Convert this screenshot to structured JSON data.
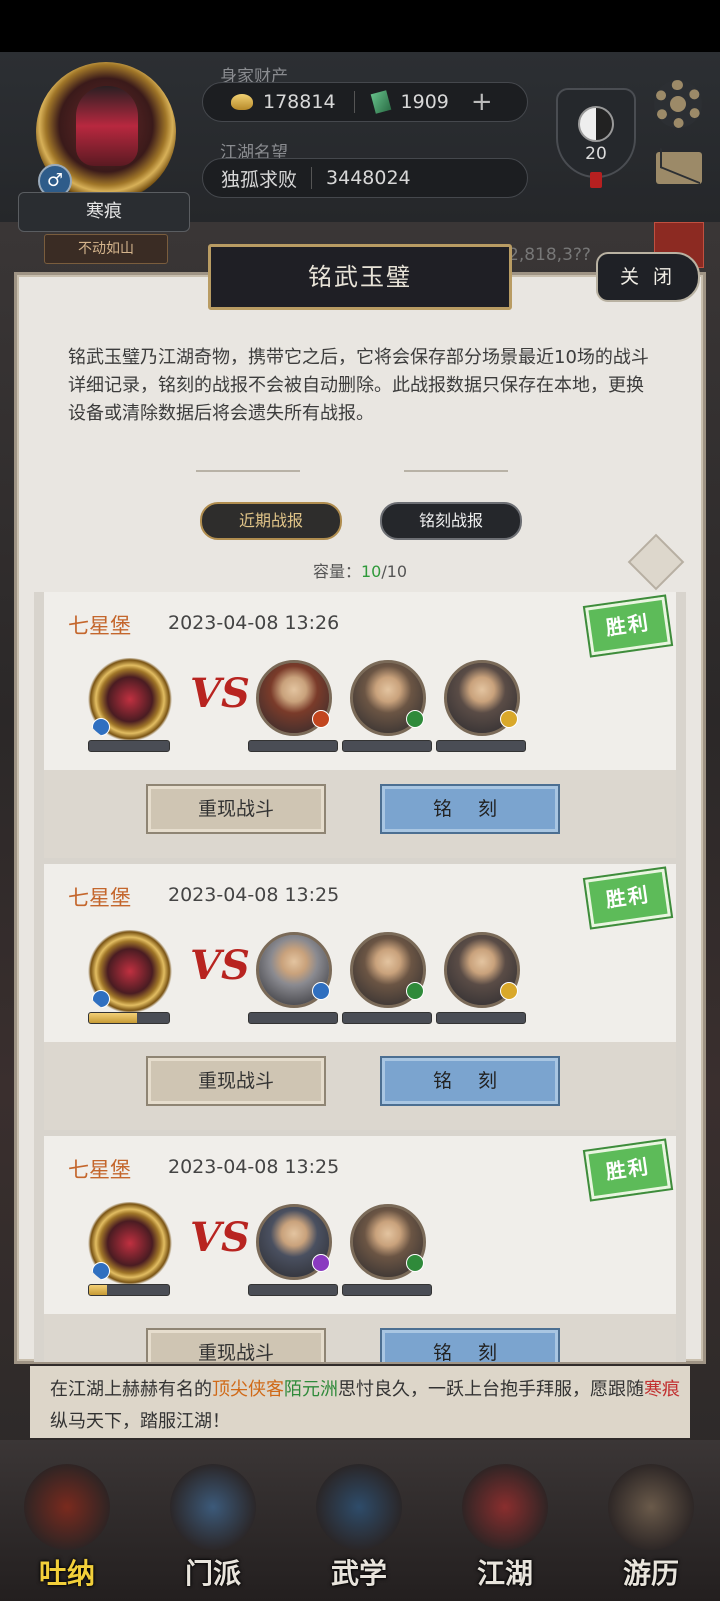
{
  "player": {
    "name": "寒痕",
    "title": "不动如山",
    "gender_icon": "♂"
  },
  "wealth": {
    "label": "身家财产",
    "gold": "178814",
    "jade": "1909",
    "plus": "+"
  },
  "reputation": {
    "label": "江湖名望",
    "rank": "独孤求败",
    "value": "3448024"
  },
  "level_badge": "20",
  "behind_text": "性：2,818,3??",
  "dialog": {
    "title": "铭武玉璧",
    "close_label": "关 闭",
    "description": "铭武玉璧乃江湖奇物，携带它之后，它将会保存部分场景最近10场的战斗详细记录，铭刻的战报不会被自动删除。此战报数据只保存在本地，更换设备或清除数据后将会遗失所有战报。",
    "tabs": [
      "近期战报",
      "铭刻战报"
    ],
    "capacity_label": "容量：",
    "capacity_current": "10",
    "capacity_total": "/10"
  },
  "reports": [
    {
      "location": "七星堡",
      "time": "2023-04-08 13:26",
      "result": "胜利",
      "self_bar": 0.0,
      "opponents": [
        {
          "skin": "#7a3b2a",
          "elem": "#c2461f"
        },
        {
          "skin": "#6b5544",
          "elem": "#2f8a3a"
        },
        {
          "skin": "#5a4c46",
          "elem": "#d9a82a"
        }
      ],
      "replay_label": "重现战斗",
      "engrave_label": "铭 刻"
    },
    {
      "location": "七星堡",
      "time": "2023-04-08 13:25",
      "result": "胜利",
      "self_bar": 0.6,
      "opponents": [
        {
          "skin": "#8a8a90",
          "elem": "#2f6fc0"
        },
        {
          "skin": "#6b5544",
          "elem": "#2f8a3a"
        },
        {
          "skin": "#5a4c46",
          "elem": "#d9a82a"
        }
      ],
      "replay_label": "重现战斗",
      "engrave_label": "铭 刻"
    },
    {
      "location": "七星堡",
      "time": "2023-04-08 13:25",
      "result": "胜利",
      "self_bar": 0.22,
      "opponents": [
        {
          "skin": "#4a5060",
          "elem": "#8a3ac0"
        },
        {
          "skin": "#6b5544",
          "elem": "#2f8a3a"
        }
      ],
      "replay_label": "重现战斗",
      "engrave_label": "铭 刻"
    }
  ],
  "vs_label": "VS",
  "footer": {
    "p1": "在江湖上赫赫有名的",
    "p2": "顶尖侠客",
    "p3": "陌元洲",
    "p4": "思忖良久，一跃上台抱手拜服，愿跟随",
    "p5": "寒痕",
    "p6": "纵马天下，踏服江湖！"
  },
  "nav": [
    {
      "label": "吐纳",
      "color": "#7a2a1e"
    },
    {
      "label": "门派",
      "color": "#3c5a7a"
    },
    {
      "label": "武学",
      "color": "#2e4c6a"
    },
    {
      "label": "江湖",
      "color": "#8a2e2e"
    },
    {
      "label": "游历",
      "color": "#6a5a4a"
    }
  ]
}
